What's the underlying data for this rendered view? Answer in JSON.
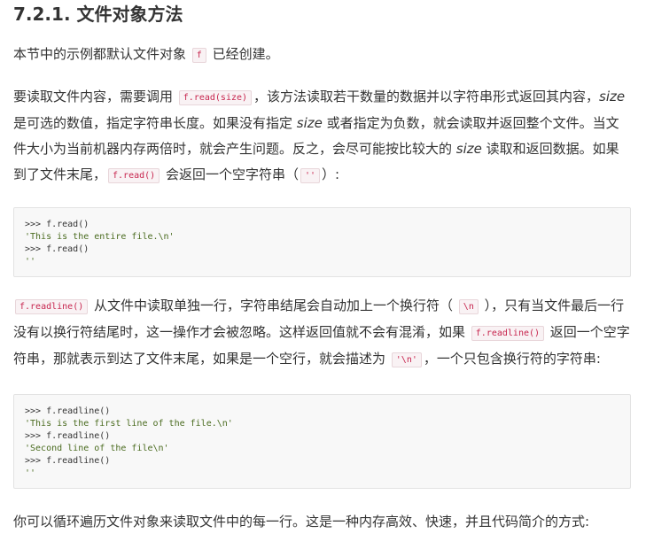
{
  "section": {
    "heading": "7.2.1. 文件对象方法"
  },
  "intro": {
    "text_before": "本节中的示例都默认文件对象 ",
    "code": "f",
    "text_after": " 已经创建。"
  },
  "para1": {
    "t1": "要读取文件内容，需要调用 ",
    "code1": "f.read(size)",
    "t2": "，该方法读取若干数量的数据并以字符串形式返回其内容，",
    "em1": "size",
    "t3": " 是可选的数值，指定字符串长度。如果没有指定 ",
    "em2": "size",
    "t4": " 或者指定为负数，就会读取并返回整个文件。当文件大小为当前机器内存两倍时，就会产生问题。反之，会尽可能按比较大的 ",
    "em3": "size",
    "t5": " 读取和返回数据。如果到了文件末尾，",
    "code2": "f.read()",
    "t6": " 会返回一个空字符串（",
    "code3": "''",
    "t7": "）:"
  },
  "code_block_1": {
    "lines": [
      ">>> f.read()",
      "'This is the entire file.\\n'",
      ">>> f.read()",
      "''"
    ]
  },
  "para2": {
    "code1": "f.readline()",
    "t1": " 从文件中读取单独一行，字符串结尾会自动加上一个换行符（ ",
    "code2": "\\n",
    "t2": " ），只有当文件最后一行没有以换行符结尾时，这一操作才会被忽略。这样返回值就不会有混淆，如果 ",
    "code3": "f.readline()",
    "t3": " 返回一个空字符串，那就表示到达了文件末尾，如果是一个空行，就会描述为 ",
    "code4": "'\\n'",
    "t4": "，一个只包含换行符的字符串:"
  },
  "code_block_2": {
    "lines": [
      ">>> f.readline()",
      "'This is the first line of the file.\\n'",
      ">>> f.readline()",
      "'Second line of the file\\n'",
      ">>> f.readline()",
      "''"
    ]
  },
  "para3": {
    "text": "你可以循环遍历文件对象来读取文件中的每一行。这是一种内存高效、快速，并且代码简介的方式:"
  }
}
